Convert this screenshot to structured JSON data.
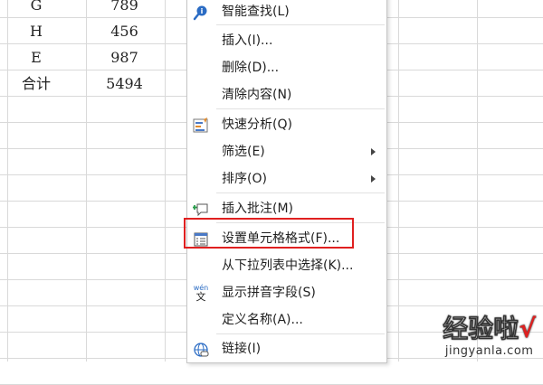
{
  "sheet": {
    "rows": [
      {
        "col1": "G",
        "col2": "789"
      },
      {
        "col1": "H",
        "col2": "456"
      },
      {
        "col1": "E",
        "col2": "987"
      },
      {
        "col1": "合计",
        "col2": "5494"
      }
    ]
  },
  "context_menu": {
    "items": [
      {
        "label": "智能查找(L)",
        "icon": "smart-lookup-icon",
        "submenu": false
      },
      {
        "label": "插入(I)...",
        "icon": "",
        "submenu": false
      },
      {
        "label": "删除(D)...",
        "icon": "",
        "submenu": false
      },
      {
        "label": "清除内容(N)",
        "icon": "",
        "submenu": false
      },
      {
        "label": "快速分析(Q)",
        "icon": "quick-analysis-icon",
        "submenu": false
      },
      {
        "label": "筛选(E)",
        "icon": "",
        "submenu": true
      },
      {
        "label": "排序(O)",
        "icon": "",
        "submenu": true
      },
      {
        "label": "插入批注(M)",
        "icon": "insert-comment-icon",
        "submenu": false
      },
      {
        "label": "设置单元格格式(F)...",
        "icon": "format-cells-icon",
        "submenu": false
      },
      {
        "label": "从下拉列表中选择(K)...",
        "icon": "",
        "submenu": false
      },
      {
        "label": "显示拼音字段(S)",
        "icon": "phonetic-icon",
        "submenu": false
      },
      {
        "label": "定义名称(A)...",
        "icon": "",
        "submenu": false
      },
      {
        "label": "链接(I)",
        "icon": "link-icon",
        "submenu": false
      }
    ],
    "phonetic_icon_text": {
      "top": "wén",
      "bottom": "文"
    }
  },
  "watermark": {
    "title": "经验啦",
    "check": "√",
    "url": "jingyanla.com"
  },
  "colors": {
    "highlight_border": "#e02020",
    "grid_line": "#d9d9d9"
  }
}
